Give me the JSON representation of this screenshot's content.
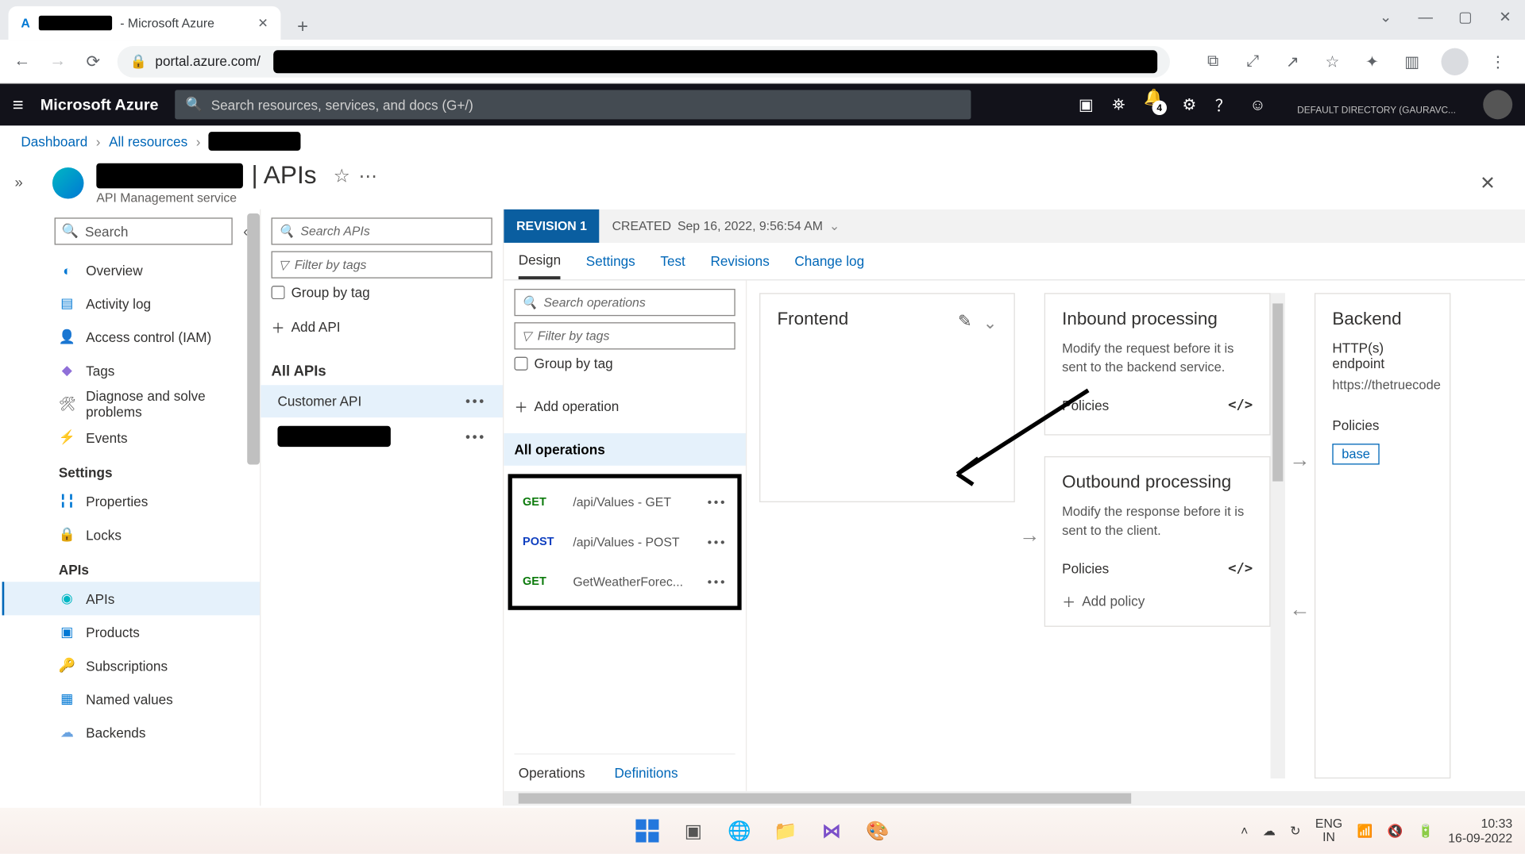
{
  "browser": {
    "tab_suffix": " - Microsoft Azure",
    "url_host": "portal.azure.com/"
  },
  "azure_top": {
    "brand": "Microsoft Azure",
    "search_placeholder": "Search resources, services, and docs (G+/)",
    "notification_count": "4",
    "directory_label": "DEFAULT DIRECTORY (GAURAVC..."
  },
  "breadcrumb": {
    "dashboard": "Dashboard",
    "all_resources": "All resources"
  },
  "page": {
    "title_suffix": "| APIs",
    "subtitle": "API Management service"
  },
  "left_menu": {
    "search_placeholder": "Search",
    "items": [
      {
        "label": "Overview",
        "icon": "globe",
        "color": "#0078d4"
      },
      {
        "label": "Activity log",
        "icon": "log",
        "color": "#0078d4"
      },
      {
        "label": "Access control (IAM)",
        "icon": "person",
        "color": "#de6500"
      },
      {
        "label": "Tags",
        "icon": "tag",
        "color": "#8f6fd8"
      },
      {
        "label": "Diagnose and solve problems",
        "icon": "wrench",
        "color": "#555"
      },
      {
        "label": "Events",
        "icon": "bolt",
        "color": "#f2b200"
      }
    ],
    "settings_header": "Settings",
    "settings": [
      {
        "label": "Properties",
        "icon": "props",
        "color": "#0078d4"
      },
      {
        "label": "Locks",
        "icon": "lock",
        "color": "#555"
      }
    ],
    "apis_header": "APIs",
    "apis": [
      {
        "label": "APIs",
        "icon": "api",
        "color": "#00b7c3",
        "selected": true
      },
      {
        "label": "Products",
        "icon": "prod",
        "color": "#0078d4"
      },
      {
        "label": "Subscriptions",
        "icon": "key",
        "color": "#f2b200"
      },
      {
        "label": "Named values",
        "icon": "nv",
        "color": "#0078d4"
      },
      {
        "label": "Backends",
        "icon": "cloud",
        "color": "#6aa3e0"
      }
    ]
  },
  "api_col": {
    "search_placeholder": "Search APIs",
    "filter_placeholder": "Filter by tags",
    "group_by_tag": "Group by tag",
    "add_api": "Add API",
    "all_apis": "All APIs",
    "apis": [
      {
        "label": "Customer API",
        "active": true
      }
    ]
  },
  "revision": {
    "tag": "REVISION 1",
    "created_prefix": "CREATED ",
    "created": "Sep 16, 2022, 9:56:54 AM"
  },
  "editor_tabs": [
    "Design",
    "Settings",
    "Test",
    "Revisions",
    "Change log"
  ],
  "ops_col": {
    "search_placeholder": "Search operations",
    "filter_placeholder": "Filter by tags",
    "group_by_tag": "Group by tag",
    "add_operation": "Add operation",
    "all_ops": "All operations",
    "ops": [
      {
        "method": "GET",
        "cls": "get",
        "name": "/api/Values - GET"
      },
      {
        "method": "POST",
        "cls": "post",
        "name": "/api/Values - POST"
      },
      {
        "method": "GET",
        "cls": "get",
        "name": "GetWeatherForec..."
      }
    ],
    "bottom_tabs": {
      "operations": "Operations",
      "definitions": "Definitions"
    }
  },
  "cards": {
    "frontend": "Frontend",
    "inbound_title": "Inbound processing",
    "inbound_desc": "Modify the request before it is sent to the backend service.",
    "outbound_title": "Outbound processing",
    "outbound_desc": "Modify the response before it is sent to the client.",
    "policies": "Policies",
    "add_policy": "Add policy",
    "backend_title": "Backend",
    "backend_endpoint_label": "HTTP(s) endpoint",
    "backend_url": "https://thetruecode",
    "base": "base"
  },
  "taskbar": {
    "lang1": "ENG",
    "lang2": "IN",
    "time": "10:33",
    "date": "16-09-2022"
  }
}
